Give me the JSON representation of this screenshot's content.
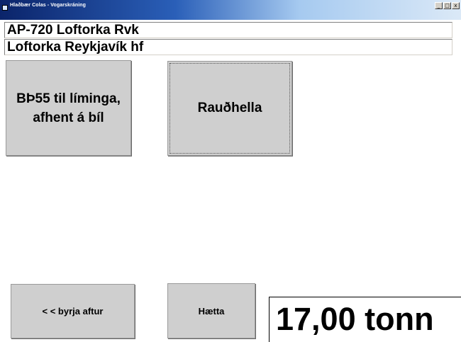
{
  "window": {
    "title": "Hlaðbær Colas - Vogarskráning",
    "controls": {
      "minimize": "_",
      "maximize": "□",
      "close": "x"
    }
  },
  "info": {
    "vehicle": "AP-720 Loftorka Rvk",
    "customer": "Loftorka Reykjavík hf"
  },
  "products": [
    {
      "label": "BÞ55 til líminga, afhent á bíl"
    },
    {
      "label": "Rauðhella"
    }
  ],
  "actions": {
    "restart_label": "< < byrja aftur",
    "quit_label": "Hætta"
  },
  "weight": {
    "display": "17,00 tonn"
  }
}
